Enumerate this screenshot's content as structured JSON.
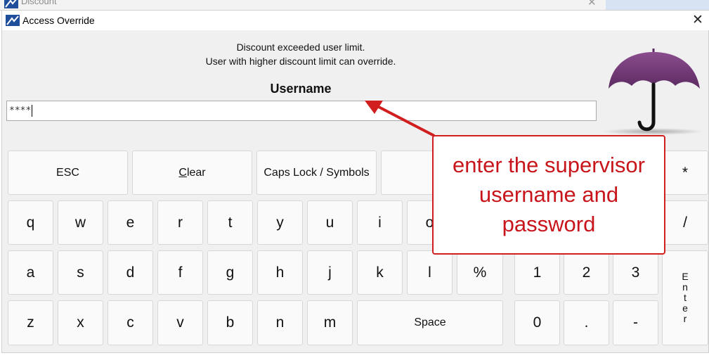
{
  "background_window": {
    "title": "Discount",
    "close_label": "✕"
  },
  "dialog": {
    "title": "Access Override",
    "close_label": "✕",
    "message_line1": "Discount exceeded user limit.",
    "message_line2": "User with higher discount limit can override.",
    "username_label": "Username",
    "username_value": "****"
  },
  "keyboard": {
    "top_row": {
      "esc": "ESC",
      "clear_prefix": "",
      "clear_underlined": "C",
      "clear_rest": "lear",
      "caps": "Caps Lock / Symbols",
      "star": "*"
    },
    "row1": [
      "q",
      "w",
      "e",
      "r",
      "t",
      "y",
      "u",
      "i",
      "o"
    ],
    "row1_slash": "/",
    "row2": [
      "a",
      "s",
      "d",
      "f",
      "g",
      "h",
      "j",
      "k",
      "l",
      "%"
    ],
    "row3": [
      "z",
      "x",
      "c",
      "v",
      "b",
      "n",
      "m"
    ],
    "space": "Space",
    "numpad_row2": [
      "1",
      "2",
      "3"
    ],
    "numpad_row3": [
      "0",
      ".",
      "-"
    ],
    "enter": "Enter"
  },
  "annotation": {
    "text": "enter the supervisor username and password",
    "color": "#d11f1f"
  },
  "colors": {
    "umbrella": "#6f3a74",
    "background": "#f0f0f0"
  }
}
